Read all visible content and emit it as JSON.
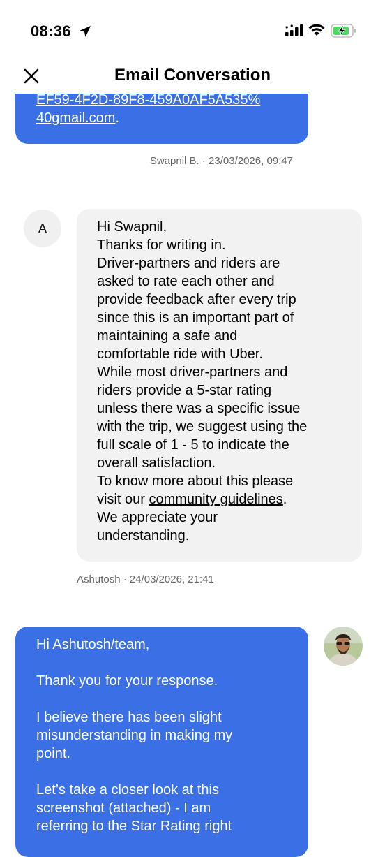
{
  "status_bar": {
    "time": "08:36",
    "icons": [
      "location-arrow-icon",
      "cellular-signal-icon",
      "wifi-icon",
      "battery-charging-icon"
    ],
    "battery_color": "#4cd964"
  },
  "header": {
    "title": "Email Conversation",
    "close_icon": "close-icon"
  },
  "messages": [
    {
      "direction": "outgoing",
      "link_line1": "EF59-4F2D-89F8-459A0AF5A535%",
      "link_line2": "40gmail.com",
      "trail": ".",
      "meta": "Swapnil B. · 23/03/2026, 09:47"
    },
    {
      "direction": "incoming",
      "avatar_letter": "A",
      "text_before_link": "Hi Swapnil,\nThanks for writing in.\nDriver-partners and riders are\nasked to rate each other and\nprovide feedback after every trip\nsince this is an important part of\nmaintaining a safe and\ncomfortable ride with Uber.\nWhile most driver-partners and\nriders provide a 5-star rating\nunless there was a specific issue\nwith the trip, we suggest using the\nfull scale of 1 - 5 to indicate the\noverall satisfaction.\nTo know more about this please\nvisit our ",
      "link_text": "community guidelines",
      "text_after_link": ".\nWe appreciate your\nunderstanding.",
      "meta": "Ashutosh · 24/03/2026, 21:41"
    },
    {
      "direction": "outgoing",
      "avatar": "user-avatar-photo",
      "text": "Hi Ashutosh/team,\n\nThank you for your response.\n\nI believe there has been slight\nmisunderstanding in making my\npoint.\n\nLet’s take a closer look at this\nscreenshot (attached) - I am\nreferring to the Star Rating right"
    }
  ],
  "colors": {
    "accent_blue": "#3a6fe6",
    "incoming_bg": "#f2f2f2",
    "meta_text": "#666666"
  }
}
